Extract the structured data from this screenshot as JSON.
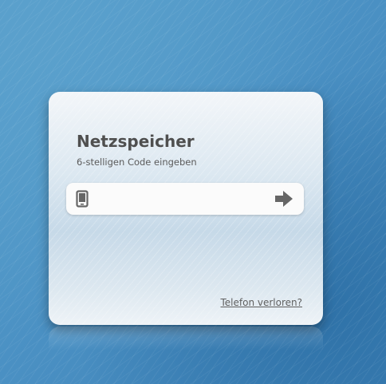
{
  "login": {
    "title": "Netzspeicher",
    "subtitle": "6-stelligen Code eingeben",
    "code_value": "",
    "code_placeholder": "",
    "lost_phone_link": "Telefon verloren?"
  },
  "icons": {
    "device": "phone-icon",
    "submit": "arrow-right-icon"
  },
  "colors": {
    "background": "#4a8fc0",
    "title": "#4f4f4f",
    "icon": "#666666"
  }
}
